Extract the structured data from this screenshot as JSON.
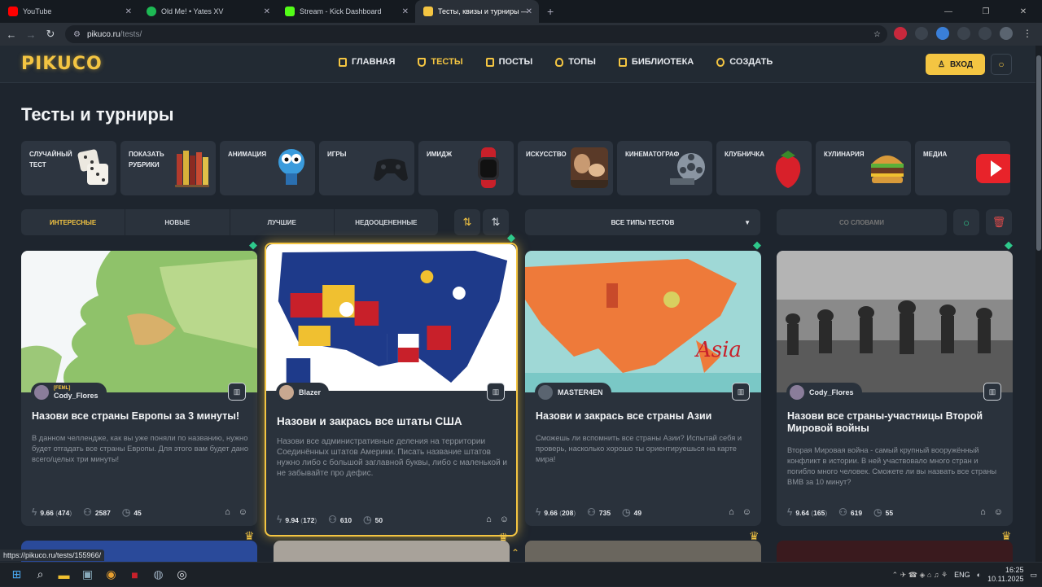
{
  "browser": {
    "tabs": [
      {
        "title": "YouTube",
        "color": "#ff0000"
      },
      {
        "title": "Old Me! • Yates XV",
        "color": "#1db954"
      },
      {
        "title": "Stream - Kick Dashboard",
        "color": "#53fc18"
      },
      {
        "title": "Тесты, квизы и турниры — Pik",
        "color": "#f4c542"
      }
    ],
    "url_host": "pikuco.ru",
    "url_path": "/tests/"
  },
  "site": {
    "logo": "PIKUCO",
    "nav": [
      {
        "label": "ГЛАВНАЯ",
        "active": false
      },
      {
        "label": "ТЕСТЫ",
        "active": true
      },
      {
        "label": "ПОСТЫ",
        "active": false
      },
      {
        "label": "ТОПЫ",
        "active": false
      },
      {
        "label": "БИБЛИОТЕКА",
        "active": false
      },
      {
        "label": "СОЗДАТЬ",
        "active": false
      }
    ],
    "login_label": "ВХОД",
    "accent": "#f4c542"
  },
  "page": {
    "title": "Тесты и турниры",
    "categories": [
      {
        "label": "СЛУЧАЙНЫЙ ТЕСТ",
        "icon": "dice-icon",
        "color": "#e8e4dc"
      },
      {
        "label": "ПОКАЗАТЬ РУБРИКИ",
        "icon": "books-icon",
        "color": "#b23a2c"
      },
      {
        "label": "АНИМАЦИЯ",
        "icon": "cartoon-icon",
        "color": "#3a9bdc"
      },
      {
        "label": "ИГРЫ",
        "icon": "gamepad-icon",
        "color": "#22262b"
      },
      {
        "label": "ИМИДЖ",
        "icon": "watch-icon",
        "color": "#c8202a"
      },
      {
        "label": "ИСКУССТВО",
        "icon": "painting-icon",
        "color": "#8a5a3a"
      },
      {
        "label": "КИНЕМАТОГРАФ",
        "icon": "film-reel-icon",
        "color": "#7a8592"
      },
      {
        "label": "КЛУБНИЧКА",
        "icon": "strawberry-icon",
        "color": "#d8202a"
      },
      {
        "label": "КУЛИНАРИЯ",
        "icon": "burger-icon",
        "color": "#c88a2a"
      },
      {
        "label": "МЕДИА",
        "icon": "play-icon",
        "color": "#e8232a"
      }
    ],
    "filters": [
      {
        "label": "ИНТЕРЕСНЫЕ",
        "active": true
      },
      {
        "label": "НОВЫЕ",
        "active": false
      },
      {
        "label": "ЛУЧШИЕ",
        "active": false
      },
      {
        "label": "НЕДООЦЕНЕННЫЕ",
        "active": false
      }
    ],
    "type_select": "ВСЕ ТИПЫ ТЕСТОВ",
    "words_placeholder": "СО СЛОВАМИ",
    "cards": [
      {
        "author_tag": "[FEML]",
        "author": "Cody_Flores",
        "title": "Назови все страны Европы за 3 минуты!",
        "desc": "В данном челлендже, как вы уже поняли по названию, нужно будет отгадать все страны Европы. Для этого вам будет дано всего/целых три минуты!",
        "rating": "9.66",
        "rating_count": "474",
        "players": "2587",
        "time": "45"
      },
      {
        "author_tag": "",
        "author": "Blazer",
        "title": "Назови и закрась все штаты США",
        "desc": "Назови все административные деления на территории Соединённых штатов Америки. Писать название штатов нужно либо с большой заглавной буквы, либо с маленькой и не забывайте про дефис.",
        "rating": "9.94",
        "rating_count": "172",
        "players": "610",
        "time": "50"
      },
      {
        "author_tag": "",
        "author": "MASTER4EN",
        "title": "Назови и закрась все страны Азии",
        "desc": "Сможешь ли вспомнить все страны Азии? Испытай себя и проверь, насколько хорошо ты ориентируешься на карте мира!",
        "rating": "9.66",
        "rating_count": "208",
        "players": "735",
        "time": "49"
      },
      {
        "author_tag": "",
        "author": "Cody_Flores",
        "title": "Назови все страны-участницы Второй Мировой войны",
        "desc": "Вторая Мировая война - самый крупный вооружённый конфликт в истории. В ней участвовало много стран и погибло много человек. Сможете ли вы назвать все страны ВМВ за 10 минут?",
        "rating": "9.64",
        "rating_count": "165",
        "players": "619",
        "time": "55"
      }
    ],
    "asia_label": "Asia"
  },
  "status_url": "https://pikuco.ru/tests/155966/",
  "taskbar": {
    "lang": "ENG",
    "time": "16:25",
    "date": "10.11.2025"
  }
}
